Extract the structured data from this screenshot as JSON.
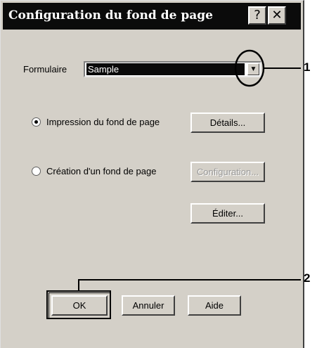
{
  "window": {
    "title": "Configuration du fond de page",
    "help_glyph": "?",
    "close_glyph": "✕"
  },
  "form": {
    "formulaire_label": "Formulaire",
    "formulaire_value": "Sample",
    "dropdown_arrow": "▼"
  },
  "options": {
    "print_label": "Impression du fond de page",
    "print_checked": true,
    "create_label": "Création d'un fond de page",
    "create_checked": false
  },
  "buttons": {
    "details": "Détails...",
    "configuration": "Configuration...",
    "edit": "Éditer...",
    "ok": "OK",
    "cancel": "Annuler",
    "help": "Aide"
  },
  "callouts": {
    "one": "1",
    "two": "2"
  }
}
